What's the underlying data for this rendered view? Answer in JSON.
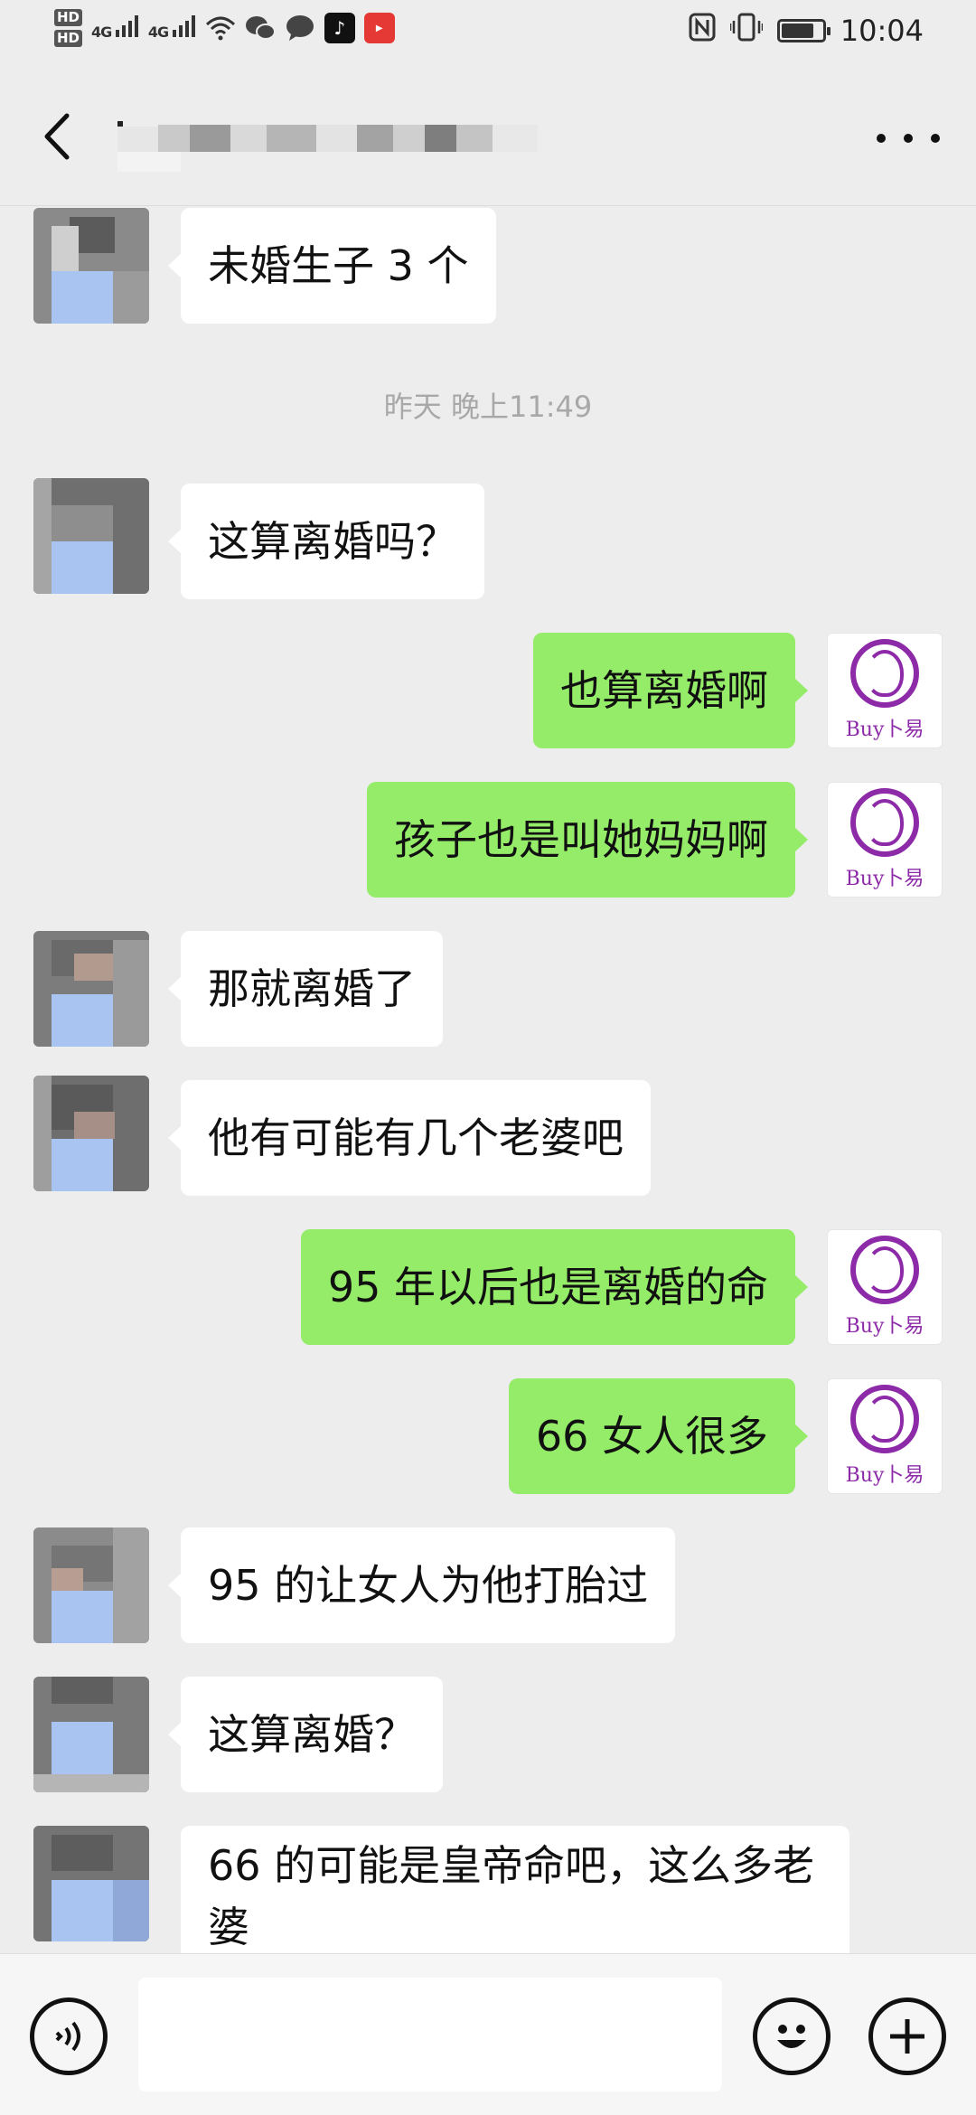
{
  "status_bar": {
    "hd1": "HD",
    "hd2": "HD",
    "signal1": "4G",
    "signal2": "4G",
    "time": "10:04",
    "battery_level": 0.8,
    "icons": [
      "hd-icon",
      "signal-icon",
      "wifi-icon",
      "wechat-icon",
      "message-icon",
      "tiktok-icon",
      "app-icon",
      "nfc-icon",
      "vibrate-icon",
      "battery-icon"
    ]
  },
  "header": {
    "title": "",
    "back_icon": "chevron-left-icon",
    "more_icon": "more-dots-icon"
  },
  "messages": [
    {
      "side": "in",
      "text": "未婚生子 3 个"
    },
    {
      "type": "timestamp",
      "text": "昨天 晚上11:49"
    },
    {
      "side": "in",
      "text": "这算离婚吗？"
    },
    {
      "side": "out",
      "text": "也算离婚啊"
    },
    {
      "side": "out",
      "text": "孩子也是叫她妈妈啊"
    },
    {
      "side": "in",
      "text": "那就离婚了"
    },
    {
      "side": "in",
      "text": "他有可能有几个老婆吧"
    },
    {
      "side": "out",
      "text": "95 年以后也是离婚的命"
    },
    {
      "side": "out",
      "text": "66 女人很多"
    },
    {
      "side": "in",
      "text": "95 的让女人为他打胎过"
    },
    {
      "side": "in",
      "text": "这算离婚？"
    },
    {
      "side": "in",
      "text": "66 的可能是皇帝命吧，这么多老婆"
    }
  ],
  "self_avatar": {
    "logo_text": "Buy卜易",
    "accent": "#8d2aa8"
  },
  "colors": {
    "outgoing_bubble": "#95ec69",
    "incoming_bubble": "#ffffff",
    "background": "#ededed"
  },
  "input_bar": {
    "value": "",
    "voice_icon": "voice-icon",
    "emoji_icon": "emoji-icon",
    "plus_icon": "plus-icon"
  }
}
